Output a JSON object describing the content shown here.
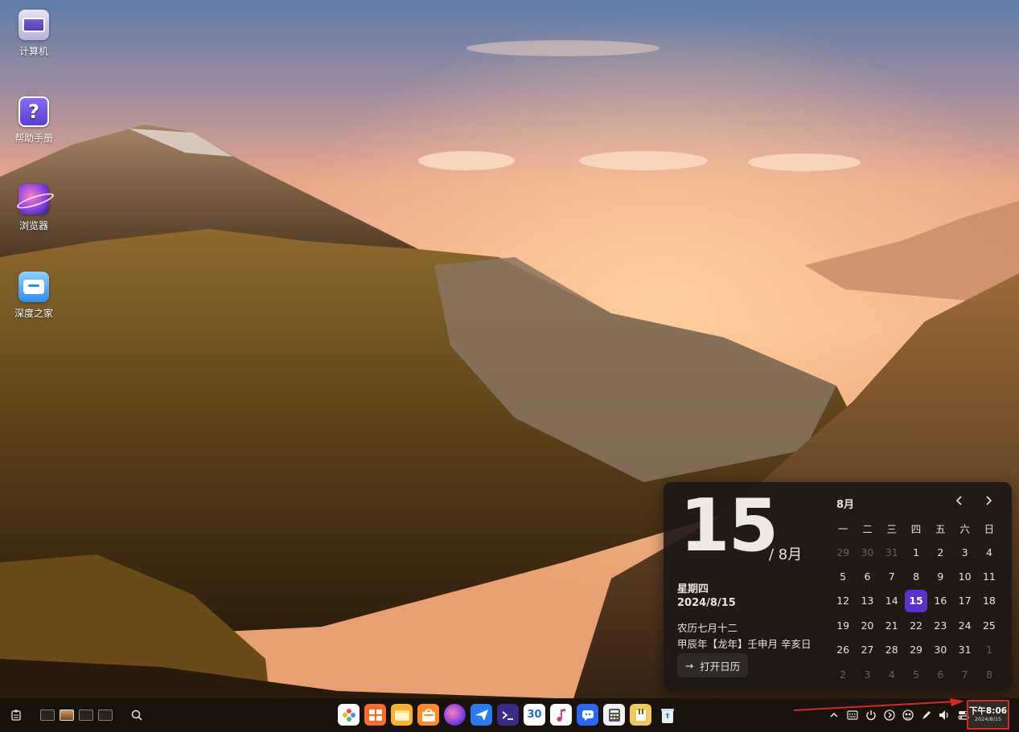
{
  "desktop": {
    "icons": [
      {
        "label": "计算机",
        "icon": "computer-icon"
      },
      {
        "label": "帮助手册",
        "icon": "help-manual-icon"
      },
      {
        "label": "浏览器",
        "icon": "browser-icon"
      },
      {
        "label": "深度之家",
        "icon": "deepin-home-icon"
      }
    ]
  },
  "calendar": {
    "big_day": "15",
    "big_month": "/ 8月",
    "weekday": "星期四",
    "full_date": "2024/8/15",
    "lunar_line1": "农历七月十二",
    "lunar_line2": "甲辰年【龙年】壬申月 辛亥日",
    "open_calendar_label": "打开日历",
    "month_label": "8月",
    "prev_icon": "chevron-left-icon",
    "next_icon": "chevron-right-icon",
    "week_headers": [
      "一",
      "二",
      "三",
      "四",
      "五",
      "六",
      "日"
    ],
    "weeks": [
      [
        "29",
        "30",
        "31",
        "1",
        "2",
        "3",
        "4"
      ],
      [
        "5",
        "6",
        "7",
        "8",
        "9",
        "10",
        "11"
      ],
      [
        "12",
        "13",
        "14",
        "15",
        "16",
        "17",
        "18"
      ],
      [
        "19",
        "20",
        "21",
        "22",
        "23",
        "24",
        "25"
      ],
      [
        "26",
        "27",
        "28",
        "29",
        "30",
        "31",
        "1"
      ],
      [
        "2",
        "3",
        "4",
        "5",
        "6",
        "7",
        "8"
      ]
    ],
    "selected_day": "15",
    "highlight_color": "#5b32d0"
  },
  "taskbar": {
    "left_icons": [
      "clipboard-icon",
      "search-icon"
    ],
    "workspaces": 4,
    "active_workspace": 2,
    "apps": [
      "launcher-icon",
      "multitask-view-icon",
      "file-manager-icon",
      "app-store-icon",
      "browser-icon",
      "mail-icon",
      "terminal-icon",
      "calendar-app-icon",
      "music-icon",
      "chat-icon",
      "calculator-icon",
      "text-editor-icon",
      "trash-icon"
    ],
    "calendar_app_text": "30",
    "tray_icons": [
      "chevron-up-icon",
      "keyboard-icon",
      "power-icon",
      "media-icon",
      "network-icon",
      "pen-icon",
      "volume-icon",
      "control-center-icon"
    ],
    "clock_time": "下午8:06",
    "clock_date": "2024/8/15",
    "annotation_color": "#d42a2a"
  }
}
